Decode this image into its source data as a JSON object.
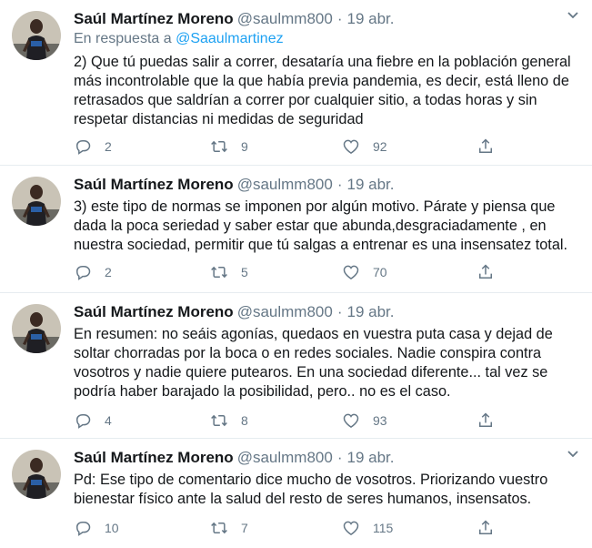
{
  "tweets": [
    {
      "name": "Saúl Martínez Moreno",
      "handle": "@saulmm800",
      "separator": "·",
      "date": "19 abr.",
      "reply_prefix": "En respuesta a",
      "reply_mention": "@Saaulmartinez",
      "text": "2) Que tú puedas salir a correr, desataría una fiebre en la población general más incontrolable que la que había previa pandemia, es decir, está lleno de retrasados que saldrían a correr por cualquier sitio, a todas horas y sin respetar distancias ni medidas de seguridad",
      "replies": "2",
      "retweets": "9",
      "likes": "92"
    },
    {
      "name": "Saúl Martínez Moreno",
      "handle": "@saulmm800",
      "separator": "·",
      "date": "19 abr.",
      "text": "3) este tipo de normas se imponen por algún motivo. Párate y piensa que dada la poca seriedad y saber estar que abunda,desgraciadamente , en nuestra sociedad, permitir que tú salgas a entrenar es una insensatez total.",
      "replies": "2",
      "retweets": "5",
      "likes": "70"
    },
    {
      "name": "Saúl Martínez Moreno",
      "handle": "@saulmm800",
      "separator": "·",
      "date": "19 abr.",
      "text": "En resumen: no seáis agonías, quedaos en vuestra puta casa y dejad de soltar chorradas por la boca o en redes sociales. Nadie conspira contra vosotros y nadie quiere putearos. En una sociedad diferente... tal vez se podría haber barajado la posibilidad, pero.. no es el caso.",
      "replies": "4",
      "retweets": "8",
      "likes": "93"
    },
    {
      "name": "Saúl Martínez Moreno",
      "handle": "@saulmm800",
      "separator": "·",
      "date": "19 abr.",
      "text": "Pd: Ese tipo de comentario dice mucho de vosotros. Priorizando vuestro bienestar físico ante la salud del resto de seres humanos, insensatos.",
      "replies": "10",
      "retweets": "7",
      "likes": "115"
    }
  ],
  "icons": {
    "reply": "reply-icon",
    "retweet": "retweet-icon",
    "like": "like-icon",
    "share": "share-icon",
    "more": "chevron-down-icon"
  },
  "colors": {
    "text": "#14171a",
    "muted": "#657786",
    "link": "#1da1f2",
    "divider": "#e6ecf0"
  }
}
